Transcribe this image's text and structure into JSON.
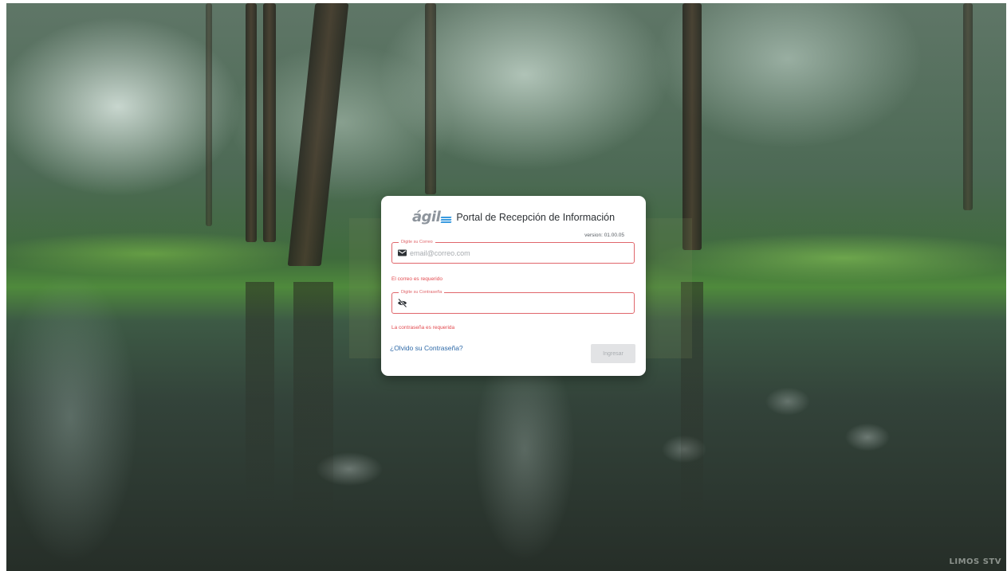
{
  "background": {
    "watermark": "LIMOS STV"
  },
  "login": {
    "brand": "ágil",
    "title": "Portal de Recepción de Información",
    "version": "version: 01.00.05",
    "email": {
      "label": "Digite su Correo",
      "placeholder": "email@correo.com",
      "value": "",
      "icon": "envelope-icon",
      "error": "El correo es requerido"
    },
    "password": {
      "label": "Digite su Contraseña",
      "placeholder": "",
      "value": "",
      "icon": "eye-slash-icon",
      "error": "La contraseña es requerida"
    },
    "forgot_link": "¿Olvido su Contraseña?",
    "submit_label": "Ingresar"
  },
  "colors": {
    "error": "#e0666b",
    "link": "#2f6aa8",
    "logo_accent": "#3b9be0",
    "button_disabled": "#e2e3e5"
  }
}
